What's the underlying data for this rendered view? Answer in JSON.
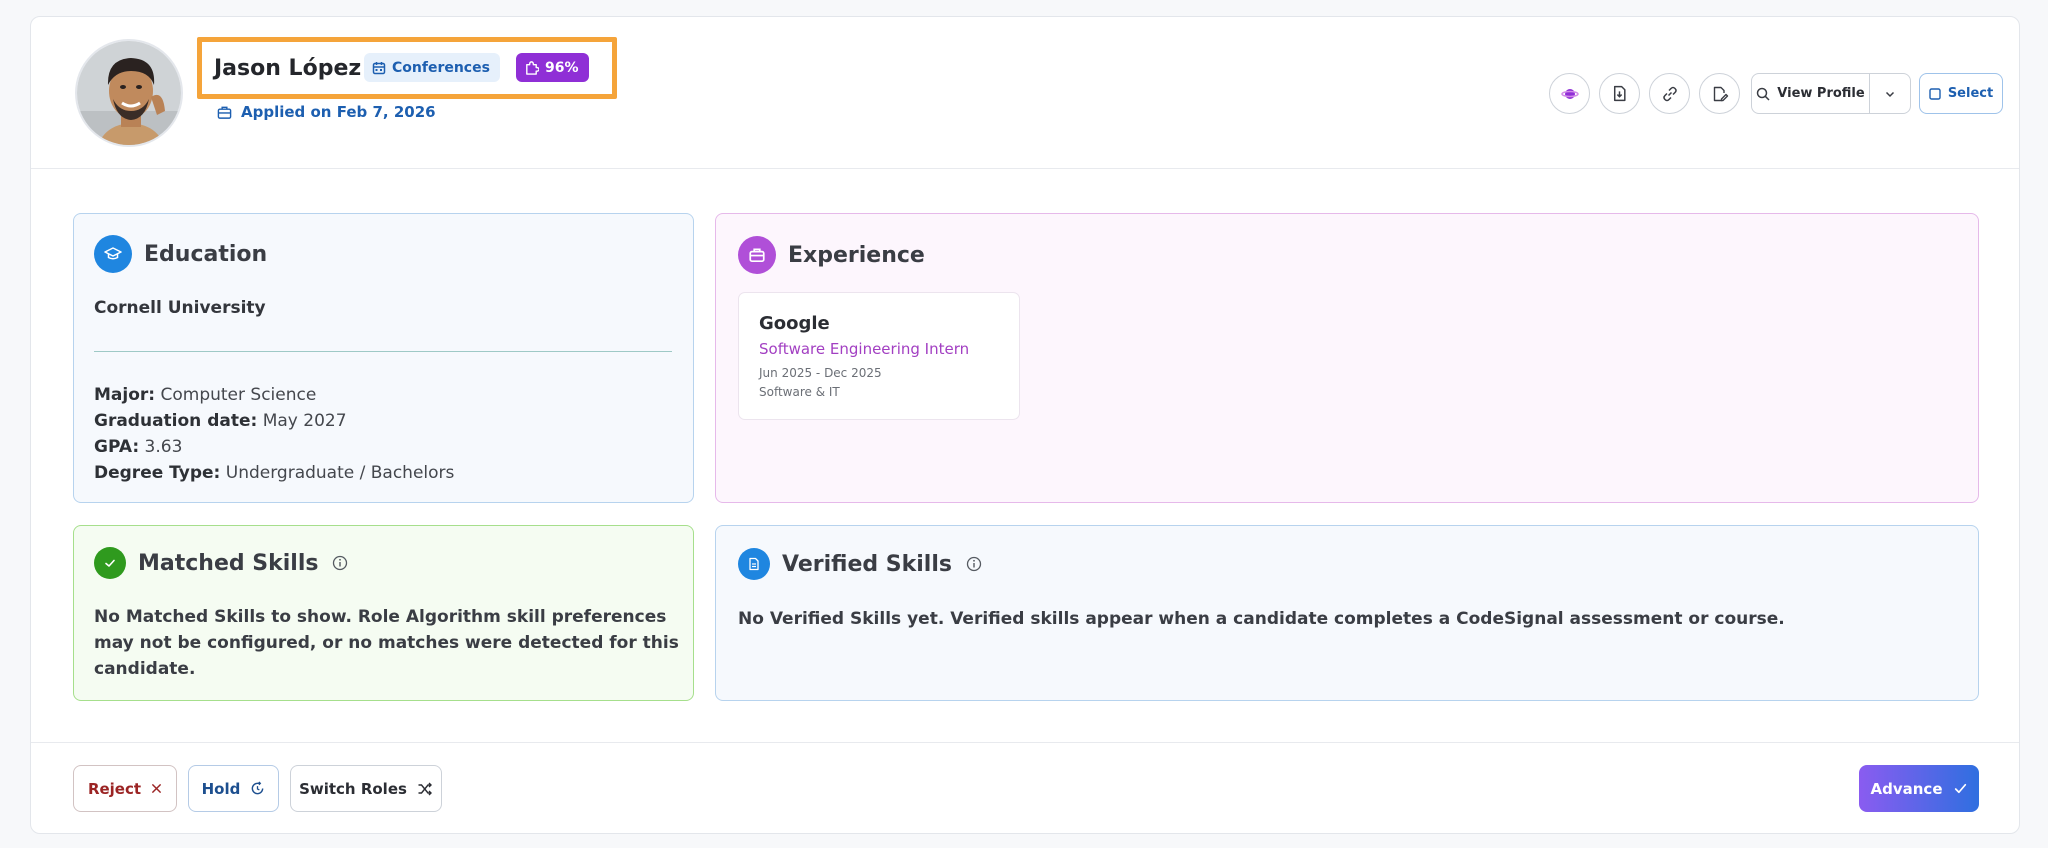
{
  "candidate": {
    "name": "Jason López",
    "source_badge": "Conferences",
    "match_score": "96%",
    "applied": "Applied on Feb 7, 2026"
  },
  "actions": {
    "view_profile": "View Profile",
    "select": "Select"
  },
  "education": {
    "title": "Education",
    "university": "Cornell University",
    "major_label": "Major:",
    "major": "Computer Science",
    "grad_label": "Graduation date:",
    "grad": "May 2027",
    "gpa_label": "GPA:",
    "gpa": "3.63",
    "degree_label": "Degree Type:",
    "degree": "Undergraduate / Bachelors"
  },
  "experience": {
    "title": "Experience",
    "items": [
      {
        "company": "Google",
        "role": "Software Engineering Intern",
        "dates": "Jun 2025 - Dec 2025",
        "industry": "Software & IT"
      }
    ]
  },
  "matched_skills": {
    "title": "Matched Skills",
    "empty_text": "No Matched Skills to show. Role Algorithm skill preferences may not be configured, or no matches were detected for this candidate."
  },
  "verified_skills": {
    "title": "Verified Skills",
    "empty_text": "No Verified Skills yet. Verified skills appear when a candidate completes a CodeSignal assessment or course."
  },
  "footer": {
    "reject": "Reject",
    "hold": "Hold",
    "switch_roles": "Switch Roles",
    "advance": "Advance"
  },
  "colors": {
    "brand_blue": "#1d5fb0",
    "score_purple": "#8f2fd6",
    "highlight_orange": "#f5a43a"
  }
}
